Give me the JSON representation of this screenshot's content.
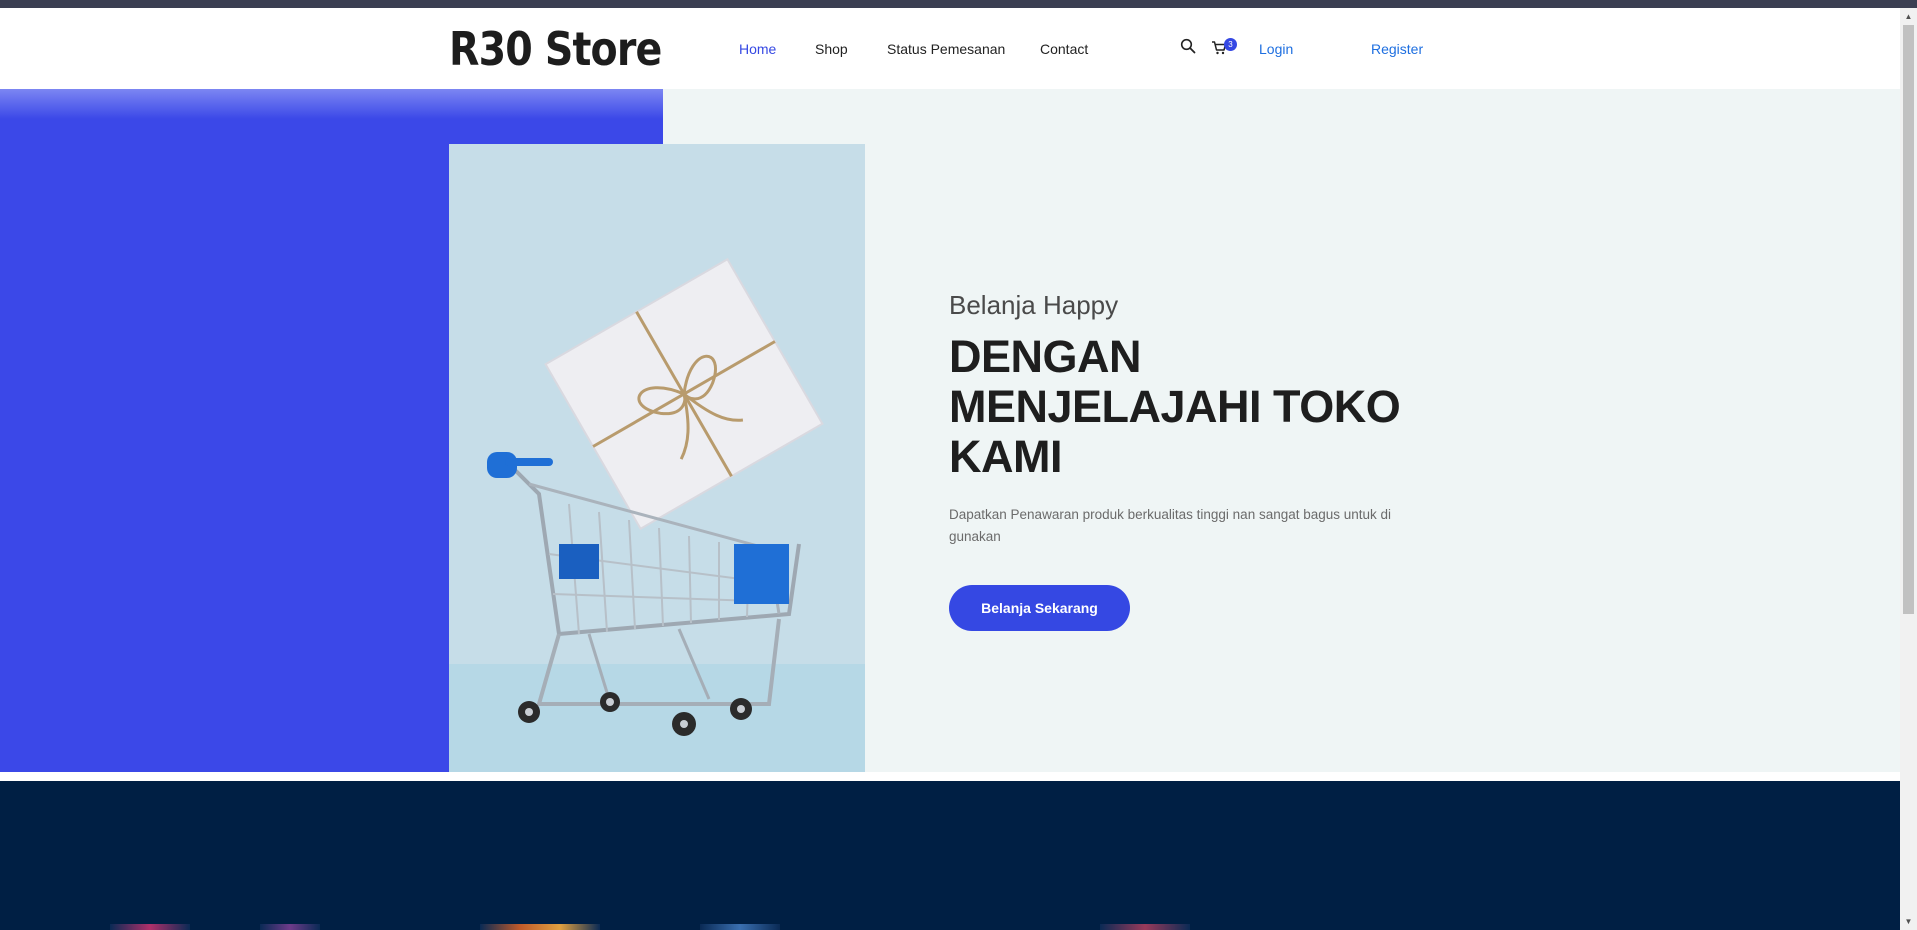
{
  "header": {
    "logo": "R30 Store",
    "nav": [
      {
        "label": "Home",
        "active": true
      },
      {
        "label": "Shop",
        "active": false
      },
      {
        "label": "Status Pemesanan",
        "active": false
      },
      {
        "label": "Contact",
        "active": false
      }
    ],
    "cart_count": "3",
    "login_label": "Login",
    "register_label": "Register"
  },
  "hero": {
    "subtitle": "Belanja Happy",
    "headline": "DENGAN MENJELAJAHI TOKO KAMI",
    "description": "Dapatkan Penawaran produk berkualitas tinggi nan sangat bagus untuk di gunakan",
    "cta_label": "Belanja Sekarang"
  },
  "colors": {
    "accent": "#3548e3",
    "hero_blue": "#3b48e8",
    "hero_bg": "#eff5f5",
    "dark_section": "#001f44",
    "link": "#1e6fe0"
  },
  "icons": {
    "search": "search-icon",
    "cart": "cart-icon",
    "hero_image": "shopping-cart-gift-photo"
  }
}
